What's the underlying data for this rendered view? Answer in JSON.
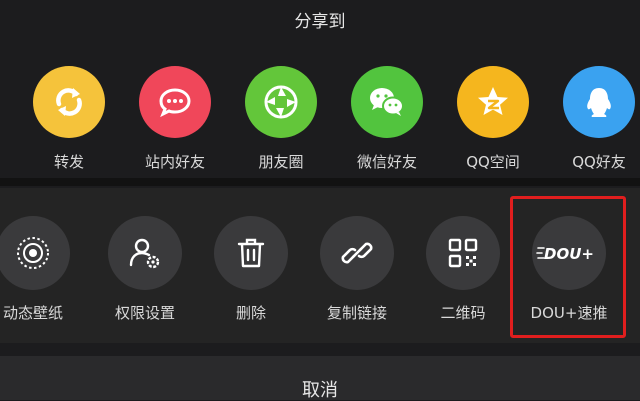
{
  "header": {
    "title": "分享到"
  },
  "share_targets": [
    {
      "label": "转发",
      "icon": "forward-icon",
      "color": "#f5c33b"
    },
    {
      "label": "站内好友",
      "icon": "chat-bubble-icon",
      "color": "#f0475a"
    },
    {
      "label": "朋友圈",
      "icon": "wechat-moments-icon",
      "color": "#63c63a"
    },
    {
      "label": "微信好友",
      "icon": "wechat-icon",
      "color": "#52c43e"
    },
    {
      "label": "QQ空间",
      "icon": "qzone-star-icon",
      "color": "#f5b61e"
    },
    {
      "label": "QQ好友",
      "icon": "qq-icon",
      "color": "#3aa2f0"
    }
  ],
  "actions": [
    {
      "label": "动态壁纸",
      "icon": "live-wallpaper-icon"
    },
    {
      "label": "权限设置",
      "icon": "user-permission-icon"
    },
    {
      "label": "删除",
      "icon": "trash-icon"
    },
    {
      "label": "复制链接",
      "icon": "link-icon"
    },
    {
      "label": "二维码",
      "icon": "qr-code-icon"
    },
    {
      "label": "DOU+速推",
      "icon": "dou-plus-icon",
      "logo_text": "DOU+"
    }
  ],
  "footer": {
    "cancel_label": "取消"
  },
  "colors": {
    "highlight_border": "#e01e1e",
    "action_circle": "#3a3a3c",
    "background": "#1c1c1e"
  }
}
